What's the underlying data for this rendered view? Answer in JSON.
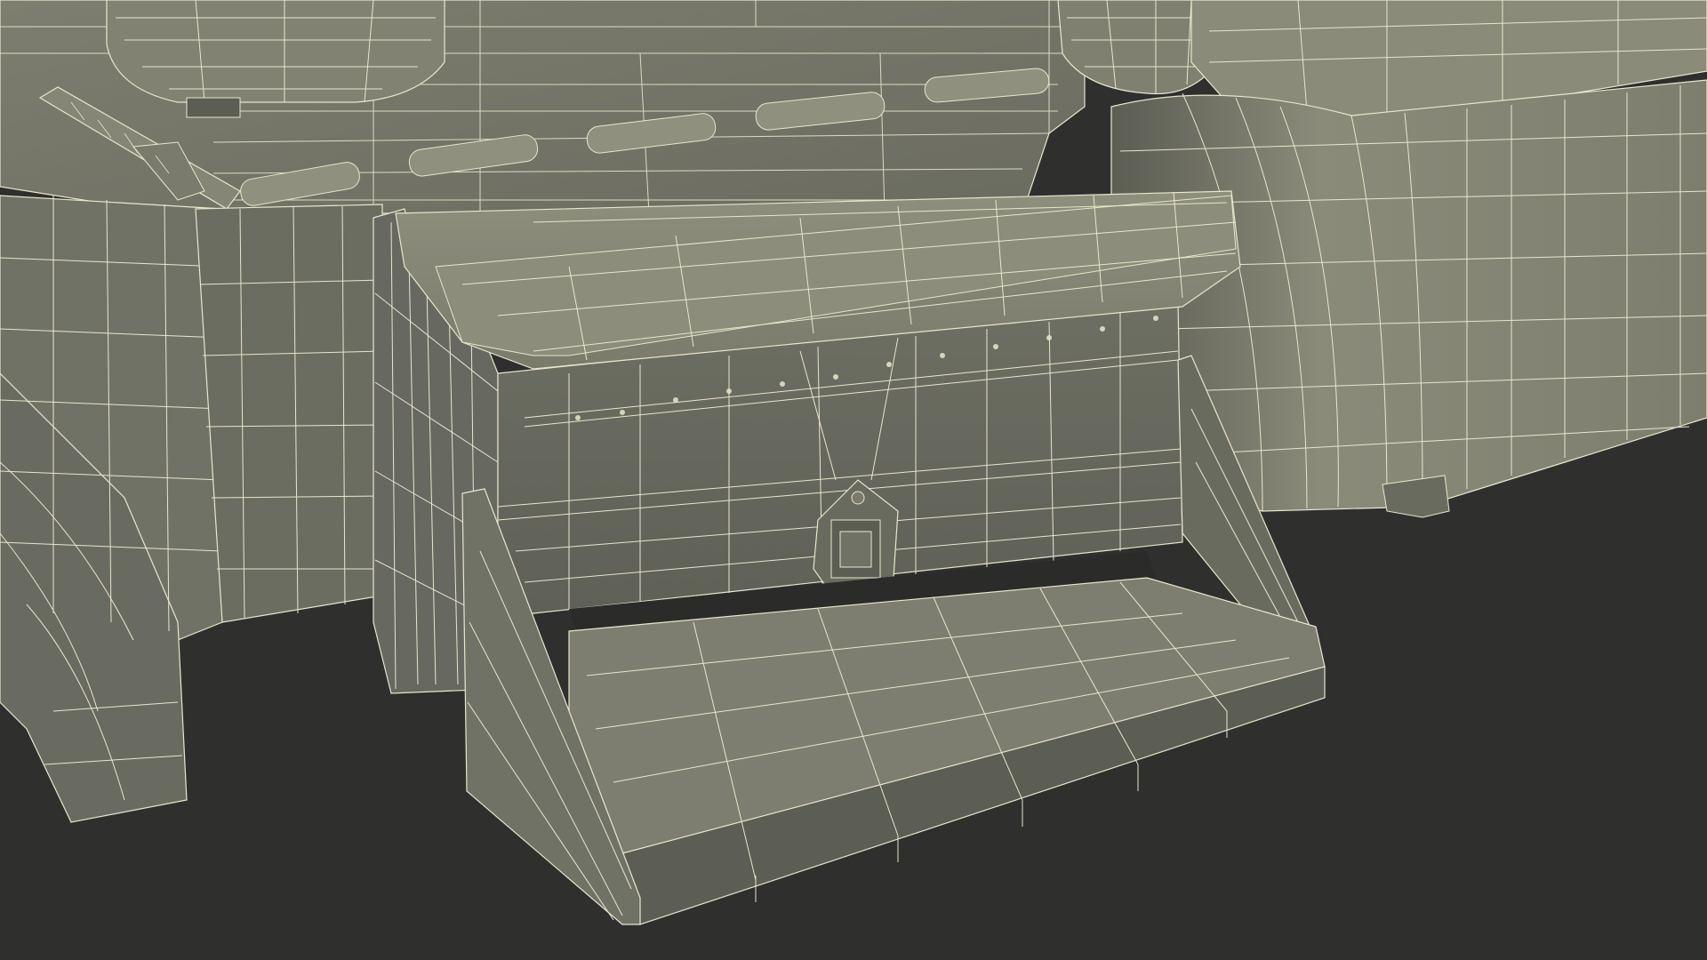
{
  "scene": {
    "subject": "wireframe-3d-render-truck-step-box",
    "colors": {
      "background": "#2f2f2e",
      "surface_light": "#8a8b79",
      "surface_mid": "#74756a",
      "surface_dark": "#5c5d53",
      "surface_shadow": "#4d4e46",
      "wire": "#e9e6cc"
    },
    "parts": [
      "fuel-tank",
      "step-box",
      "toolbox-lid",
      "step-tread",
      "side-bracket",
      "handle",
      "grab-handle",
      "marker-lights",
      "mudflap",
      "cab-panel",
      "exhaust-tank-right",
      "upper-box-right"
    ]
  }
}
